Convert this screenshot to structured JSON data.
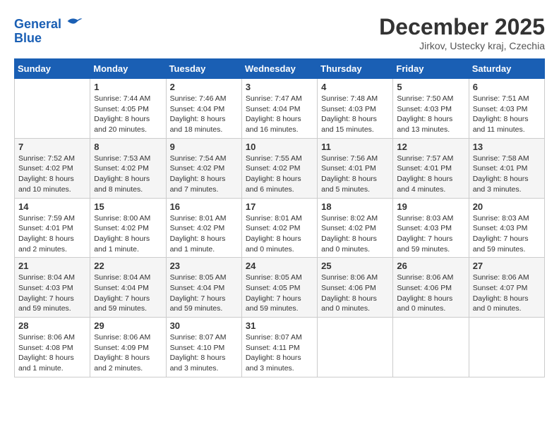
{
  "header": {
    "logo_line1": "General",
    "logo_line2": "Blue",
    "month_title": "December 2025",
    "location": "Jirkov, Ustecky kraj, Czechia"
  },
  "weekdays": [
    "Sunday",
    "Monday",
    "Tuesday",
    "Wednesday",
    "Thursday",
    "Friday",
    "Saturday"
  ],
  "weeks": [
    [
      {
        "day": "",
        "info": ""
      },
      {
        "day": "1",
        "info": "Sunrise: 7:44 AM\nSunset: 4:05 PM\nDaylight: 8 hours\nand 20 minutes."
      },
      {
        "day": "2",
        "info": "Sunrise: 7:46 AM\nSunset: 4:04 PM\nDaylight: 8 hours\nand 18 minutes."
      },
      {
        "day": "3",
        "info": "Sunrise: 7:47 AM\nSunset: 4:04 PM\nDaylight: 8 hours\nand 16 minutes."
      },
      {
        "day": "4",
        "info": "Sunrise: 7:48 AM\nSunset: 4:03 PM\nDaylight: 8 hours\nand 15 minutes."
      },
      {
        "day": "5",
        "info": "Sunrise: 7:50 AM\nSunset: 4:03 PM\nDaylight: 8 hours\nand 13 minutes."
      },
      {
        "day": "6",
        "info": "Sunrise: 7:51 AM\nSunset: 4:03 PM\nDaylight: 8 hours\nand 11 minutes."
      }
    ],
    [
      {
        "day": "7",
        "info": "Sunrise: 7:52 AM\nSunset: 4:02 PM\nDaylight: 8 hours\nand 10 minutes."
      },
      {
        "day": "8",
        "info": "Sunrise: 7:53 AM\nSunset: 4:02 PM\nDaylight: 8 hours\nand 8 minutes."
      },
      {
        "day": "9",
        "info": "Sunrise: 7:54 AM\nSunset: 4:02 PM\nDaylight: 8 hours\nand 7 minutes."
      },
      {
        "day": "10",
        "info": "Sunrise: 7:55 AM\nSunset: 4:02 PM\nDaylight: 8 hours\nand 6 minutes."
      },
      {
        "day": "11",
        "info": "Sunrise: 7:56 AM\nSunset: 4:01 PM\nDaylight: 8 hours\nand 5 minutes."
      },
      {
        "day": "12",
        "info": "Sunrise: 7:57 AM\nSunset: 4:01 PM\nDaylight: 8 hours\nand 4 minutes."
      },
      {
        "day": "13",
        "info": "Sunrise: 7:58 AM\nSunset: 4:01 PM\nDaylight: 8 hours\nand 3 minutes."
      }
    ],
    [
      {
        "day": "14",
        "info": "Sunrise: 7:59 AM\nSunset: 4:01 PM\nDaylight: 8 hours\nand 2 minutes."
      },
      {
        "day": "15",
        "info": "Sunrise: 8:00 AM\nSunset: 4:02 PM\nDaylight: 8 hours\nand 1 minute."
      },
      {
        "day": "16",
        "info": "Sunrise: 8:01 AM\nSunset: 4:02 PM\nDaylight: 8 hours\nand 1 minute."
      },
      {
        "day": "17",
        "info": "Sunrise: 8:01 AM\nSunset: 4:02 PM\nDaylight: 8 hours\nand 0 minutes."
      },
      {
        "day": "18",
        "info": "Sunrise: 8:02 AM\nSunset: 4:02 PM\nDaylight: 8 hours\nand 0 minutes."
      },
      {
        "day": "19",
        "info": "Sunrise: 8:03 AM\nSunset: 4:03 PM\nDaylight: 7 hours\nand 59 minutes."
      },
      {
        "day": "20",
        "info": "Sunrise: 8:03 AM\nSunset: 4:03 PM\nDaylight: 7 hours\nand 59 minutes."
      }
    ],
    [
      {
        "day": "21",
        "info": "Sunrise: 8:04 AM\nSunset: 4:03 PM\nDaylight: 7 hours\nand 59 minutes."
      },
      {
        "day": "22",
        "info": "Sunrise: 8:04 AM\nSunset: 4:04 PM\nDaylight: 7 hours\nand 59 minutes."
      },
      {
        "day": "23",
        "info": "Sunrise: 8:05 AM\nSunset: 4:04 PM\nDaylight: 7 hours\nand 59 minutes."
      },
      {
        "day": "24",
        "info": "Sunrise: 8:05 AM\nSunset: 4:05 PM\nDaylight: 7 hours\nand 59 minutes."
      },
      {
        "day": "25",
        "info": "Sunrise: 8:06 AM\nSunset: 4:06 PM\nDaylight: 8 hours\nand 0 minutes."
      },
      {
        "day": "26",
        "info": "Sunrise: 8:06 AM\nSunset: 4:06 PM\nDaylight: 8 hours\nand 0 minutes."
      },
      {
        "day": "27",
        "info": "Sunrise: 8:06 AM\nSunset: 4:07 PM\nDaylight: 8 hours\nand 0 minutes."
      }
    ],
    [
      {
        "day": "28",
        "info": "Sunrise: 8:06 AM\nSunset: 4:08 PM\nDaylight: 8 hours\nand 1 minute."
      },
      {
        "day": "29",
        "info": "Sunrise: 8:06 AM\nSunset: 4:09 PM\nDaylight: 8 hours\nand 2 minutes."
      },
      {
        "day": "30",
        "info": "Sunrise: 8:07 AM\nSunset: 4:10 PM\nDaylight: 8 hours\nand 3 minutes."
      },
      {
        "day": "31",
        "info": "Sunrise: 8:07 AM\nSunset: 4:11 PM\nDaylight: 8 hours\nand 3 minutes."
      },
      {
        "day": "",
        "info": ""
      },
      {
        "day": "",
        "info": ""
      },
      {
        "day": "",
        "info": ""
      }
    ]
  ]
}
